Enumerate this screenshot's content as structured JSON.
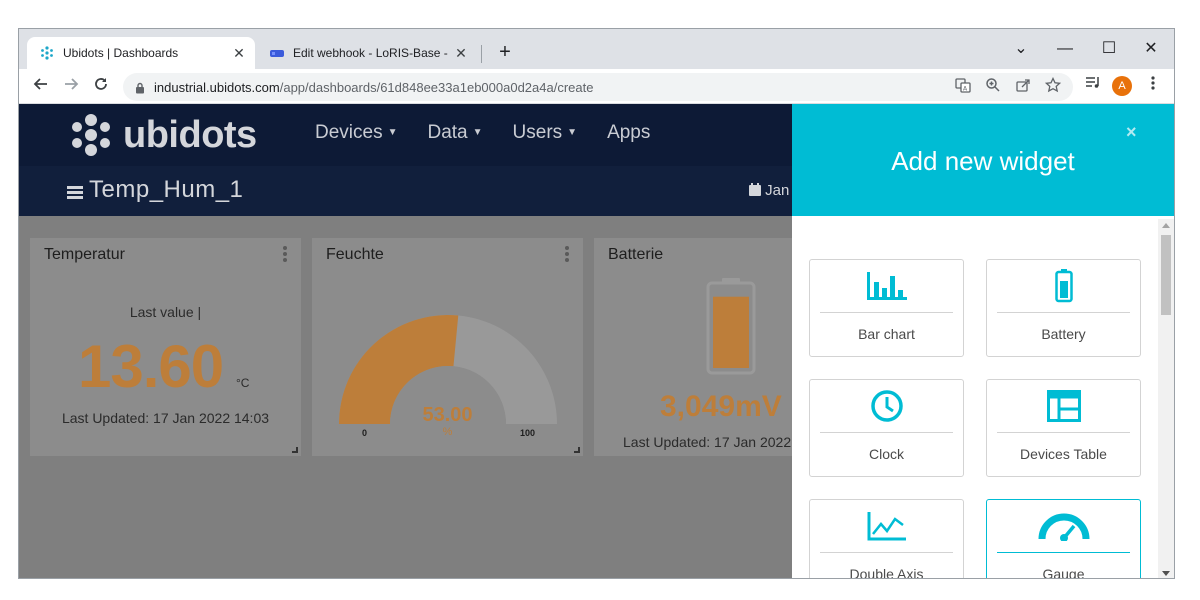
{
  "browser": {
    "tabs": [
      {
        "title": "Ubidots | Dashboards",
        "close": "✕"
      },
      {
        "title": "Edit webhook - LoRIS-Base - The",
        "close": "✕"
      }
    ],
    "new_tab": "+",
    "window_controls": {
      "minimize": "⌄",
      "restore": "—",
      "maximize": "☐",
      "close": "✕"
    },
    "url_domain": "industrial.ubidots.com",
    "url_path": "/app/dashboards/61d848ee33a1eb000a0d2a4a/create",
    "avatar_initial": "A",
    "icons": [
      "back-icon",
      "forward-icon",
      "reload-icon",
      "lock-icon",
      "translate-icon",
      "zoom-icon",
      "share-icon",
      "star-icon",
      "reading-list-icon",
      "menu-dots-icon"
    ]
  },
  "app": {
    "logo_text": "ubidots",
    "nav": [
      {
        "label": "Devices",
        "dropdown": true
      },
      {
        "label": "Data",
        "dropdown": true
      },
      {
        "label": "Users",
        "dropdown": true
      },
      {
        "label": "Apps",
        "dropdown": false
      }
    ],
    "dashboard_title": "Temp_Hum_1",
    "date_label": "Jan"
  },
  "widgets": {
    "temperature": {
      "title": "Temperatur",
      "caption": "Last value |",
      "value": "13.60",
      "unit": "°C",
      "updated": "Last Updated: 17 Jan 2022 14:03"
    },
    "humidity": {
      "title": "Feuchte",
      "value": "53.00",
      "unit": "%",
      "min": "0",
      "max": "100",
      "fraction": 0.53
    },
    "battery": {
      "title": "Batterie",
      "value": "3,049mV",
      "updated": "Last Updated: 17 Jan 2022",
      "fill_fraction": 0.88
    }
  },
  "panel": {
    "title": "Add new widget",
    "close": "×",
    "cards": [
      {
        "label": "Bar chart",
        "icon": "bar-chart-icon"
      },
      {
        "label": "Battery",
        "icon": "battery-icon"
      },
      {
        "label": "Clock",
        "icon": "clock-icon"
      },
      {
        "label": "Devices Table",
        "icon": "table-icon"
      },
      {
        "label": "Double Axis",
        "icon": "line-chart-icon"
      },
      {
        "label": "Gauge",
        "icon": "gauge-icon"
      }
    ]
  },
  "colors": {
    "accent": "#00bcd4",
    "value_orange": "#bd7e3a",
    "appbar": "#0d1a36"
  }
}
